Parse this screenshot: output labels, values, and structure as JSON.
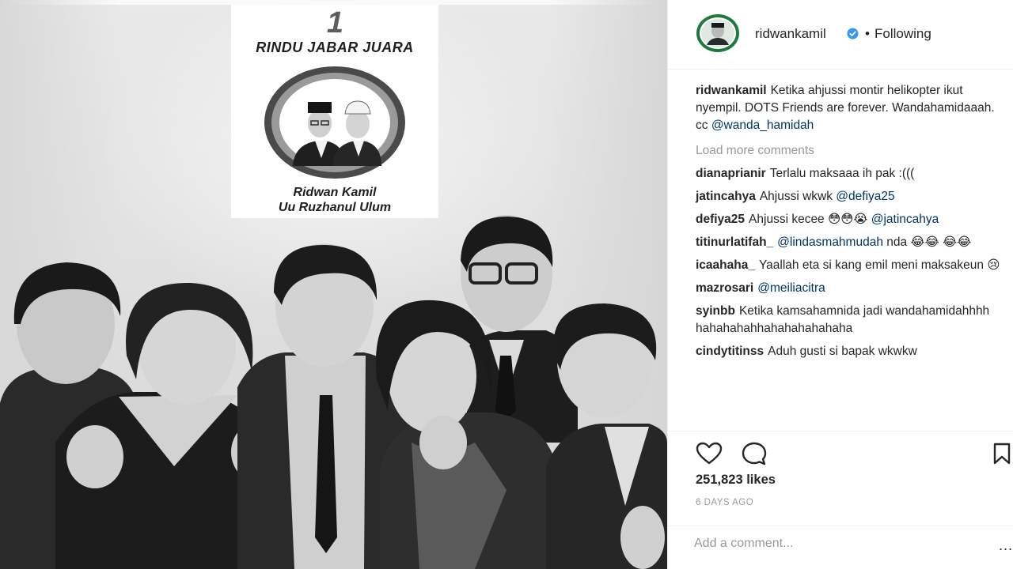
{
  "post": {
    "badge": {
      "number": "1",
      "title": "RINDU JABAR JUARA",
      "name_line1": "Ridwan Kamil",
      "name_line2": "Uu Ruzhanul Ulum"
    }
  },
  "header": {
    "username": "ridwankamil",
    "separator": "•",
    "follow_label": "Following"
  },
  "caption": {
    "username": "ridwankamil",
    "text": "Ketika ahjussi montir helikopter ikut nyempil. DOTS Friends are forever. Wandahamidaaah. cc",
    "mention": "@wanda_hamidah"
  },
  "load_more_label": "Load more comments",
  "comments": [
    {
      "username": "dianaprianir",
      "text": "Terlalu maksaaa ih pak :(((",
      "mention": ""
    },
    {
      "username": "jatincahya",
      "text": "Ahjussi wkwk",
      "mention": "@defiya25"
    },
    {
      "username": "defiya25",
      "text": "Ahjussi kecee 😳😳😭",
      "mention": "@jatincahya"
    },
    {
      "username": "titinurlatifah_",
      "text": "",
      "mention": "@lindasmahmudah",
      "tail": "nda 😂😂 😂😂"
    },
    {
      "username": "icaahaha_",
      "text": "Yaallah eta si kang emil meni maksakeun 😢",
      "mention": ""
    },
    {
      "username": "mazrosari",
      "text": "",
      "mention": "@meiliacitra"
    },
    {
      "username": "syinbb",
      "text": "Ketika kamsahamnida jadi wandahamidahhhh hahahahahhahahahahahaha",
      "mention": ""
    },
    {
      "username": "cindytitinss",
      "text": "Aduh gusti si bapak wkwkw",
      "mention": ""
    }
  ],
  "likes_label": "251,823 likes",
  "timestamp": "6 DAYS AGO",
  "add_comment_placeholder": "Add a comment...",
  "more_options": "...",
  "colors": {
    "text": "#262626",
    "muted": "#999999",
    "mention": "#003569",
    "verified": "#3897f0",
    "avatar_ring": "#1e7a3a"
  }
}
